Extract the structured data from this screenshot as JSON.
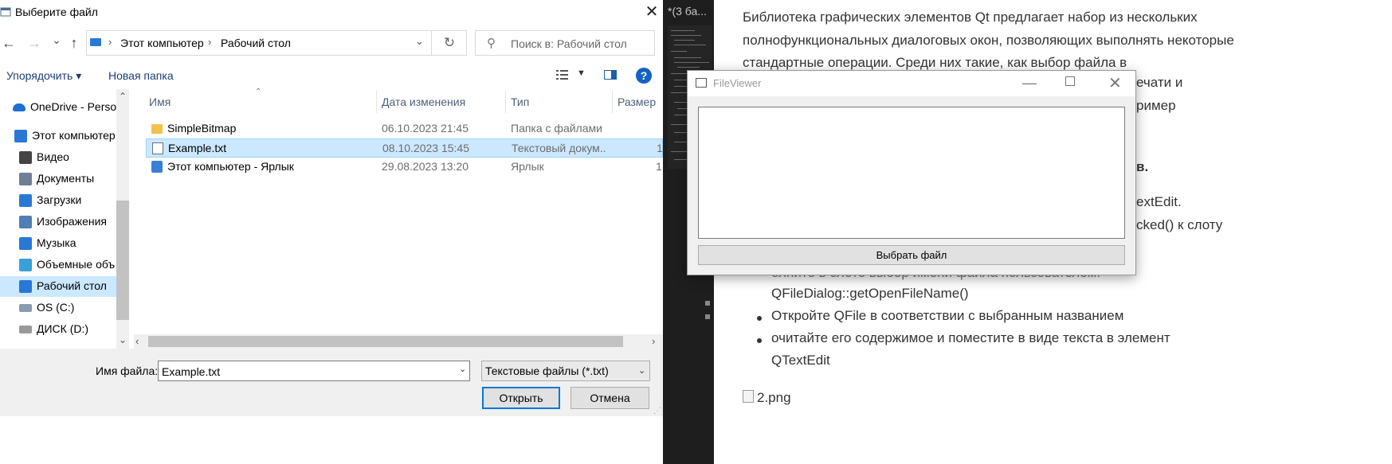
{
  "dialog": {
    "title": "Выберите файл",
    "close_glyph": "✕",
    "nav": {
      "back": "←",
      "forward": "→",
      "recent": "⌄",
      "up": "↑"
    },
    "address": {
      "crumbs": [
        "Этот компьютер",
        "Рабочий стол"
      ],
      "separator": "›",
      "dropdown": "⌄",
      "refresh": "↻"
    },
    "search": {
      "placeholder": "Поиск в: Рабочий стол",
      "icon": "⚲"
    },
    "toolbar": {
      "organize_label": "Упорядочить ▾",
      "new_folder_label": "Новая папка",
      "view_dropdown": "▼",
      "help": "?"
    },
    "nav_pane": {
      "items": [
        {
          "label": "OneDrive - Person",
          "icon": "onedrive-icon"
        },
        {
          "label": "Этот компьютер",
          "icon": "computer-icon"
        },
        {
          "label": "Видео",
          "icon": "video-icon"
        },
        {
          "label": "Документы",
          "icon": "documents-icon"
        },
        {
          "label": "Загрузки",
          "icon": "downloads-icon"
        },
        {
          "label": "Изображения",
          "icon": "pictures-icon"
        },
        {
          "label": "Музыка",
          "icon": "music-icon"
        },
        {
          "label": "Объемные объ",
          "icon": "3d-objects-icon"
        },
        {
          "label": "Рабочий стол",
          "icon": "desktop-icon",
          "selected": true
        },
        {
          "label": "OS (C:)",
          "icon": "drive-c-icon"
        },
        {
          "label": "ДИСК (D:)",
          "icon": "drive-d-icon"
        }
      ],
      "scroll_up": "⌃",
      "scroll_down": "⌄"
    },
    "columns": [
      "Имя",
      "Дата изменения",
      "Тип",
      "Размер"
    ],
    "sort_indicator": "⌃",
    "files": [
      {
        "name": "SimpleBitmap",
        "date": "06.10.2023 21:45",
        "type": "Папка с файлами",
        "size": "",
        "icon": "folder-icon"
      },
      {
        "name": "Example.txt",
        "date": "08.10.2023 15:45",
        "type": "Текстовый докум...",
        "size": "1",
        "icon": "text-file-icon",
        "selected": true
      },
      {
        "name": "Этот компьютер - Ярлык",
        "date": "29.08.2023 13:20",
        "type": "Ярлык",
        "size": "1",
        "icon": "shortcut-icon"
      }
    ],
    "hscroll": {
      "left": "‹",
      "right": "›"
    },
    "filename_label": "Имя файла:",
    "filename_value": "Example.txt",
    "filename_dropdown": "⌄",
    "filter_value": "Текстовые файлы (*.txt)",
    "filter_dropdown": "⌄",
    "open_label": "Открыть",
    "cancel_label": "Отмена",
    "resize_grip": "⋰"
  },
  "editor": {
    "tab_label": "*(3 ба..."
  },
  "doc": {
    "paragraph": "Библиотека графических элементов Qt предлагает набор из нескольких полнофункциональных диалоговых окон, позволяющих выполнять некоторые стандартные операции. Среди них такие, как выбор файла в",
    "fragments": {
      "f1": "ечати и",
      "f2": "ример",
      "f3": "в.",
      "f4": "extEdit.",
      "f5": "cked() к слоту",
      "f6": "олните в слоте выбор имени файла пользователем:"
    },
    "list": [
      {
        "text": "QFileDialog::getOpenFileName()",
        "bullet": false
      },
      {
        "text": "Откройте QFile в соответствии с выбранным названием",
        "bullet": true
      },
      {
        "text": "очитайте его содержимое и поместите в виде текста в элемент",
        "bullet": true
      },
      {
        "text": "QTextEdit",
        "bullet": false
      }
    ],
    "image_alt": "2.png"
  },
  "fileviewer": {
    "title": "FileViewer",
    "min_glyph": "—",
    "close_glyph": "✕",
    "text_value": "",
    "button_label": "Выбрать файл"
  },
  "colors": {
    "selection": "#cce8ff",
    "selection_border": "#99d1ff",
    "accent": "#0078d7",
    "editor_bg": "#1e1e1e"
  }
}
